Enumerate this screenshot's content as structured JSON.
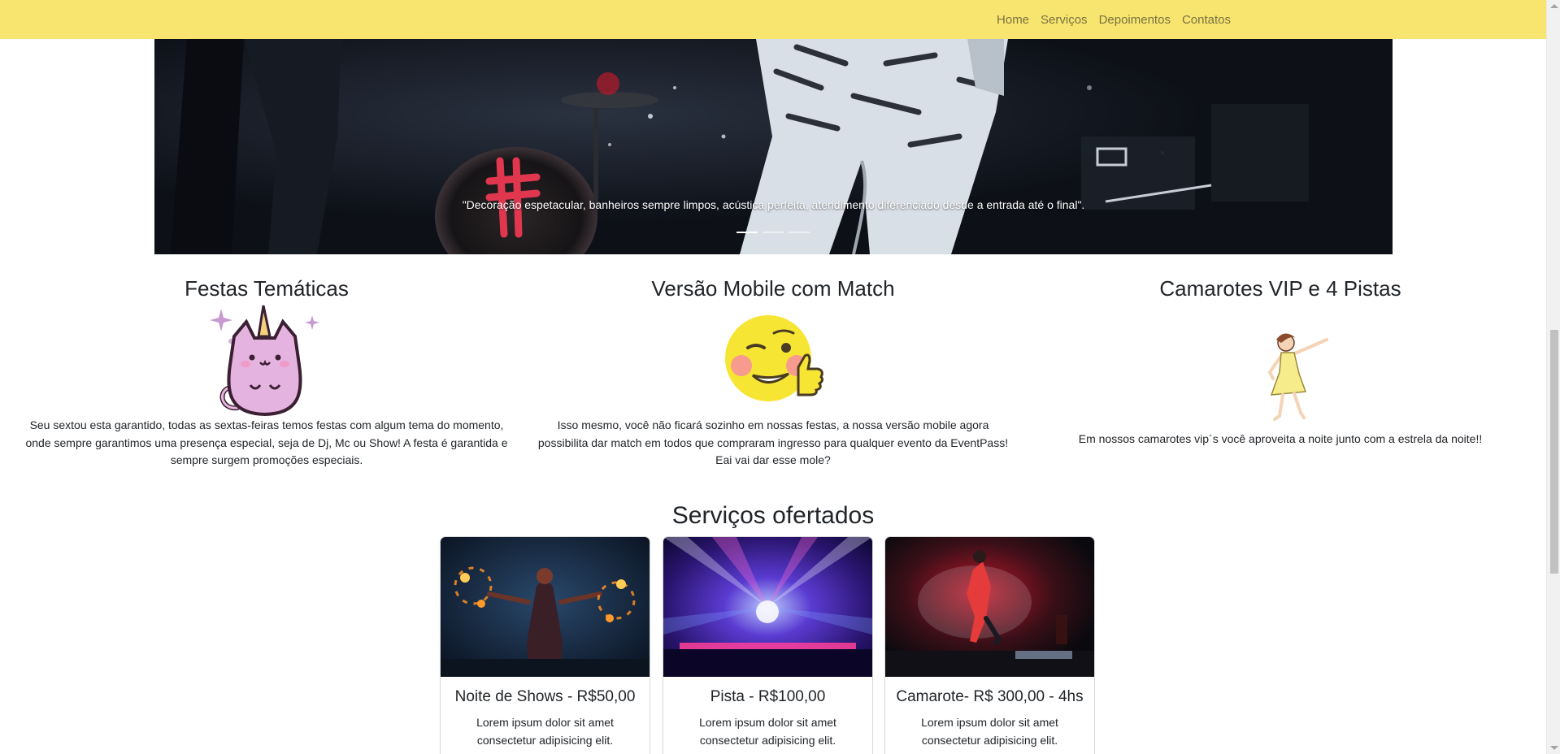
{
  "nav": {
    "links": [
      "Home",
      "Serviços",
      "Depoimentos",
      "Contatos"
    ]
  },
  "carousel": {
    "caption": "\"Decoração espetacular, banheiros sempre limpos, acústica perfeita, atendimento diferenciado desde a entrada até o final\".",
    "slide_count": 3,
    "active_slide": 1
  },
  "features": [
    {
      "title": "Festas Temáticas",
      "icon": "unicorn-cat-icon",
      "text": "Seu sextou esta garantido, todas as sextas-feiras temos festas com algum tema do momento, onde sempre garantimos uma presença especial, seja de Dj, Mc ou Show! A festa é garantida e sempre surgem promoções especiais."
    },
    {
      "title": "Versão Mobile com Match",
      "icon": "winking-thumbs-up-emoji-icon",
      "text": "Isso mesmo, você não ficará sozinho em nossas festas, a nossa versão mobile agora possibilita dar match em todos que compraram ingresso para qualquer evento da EventPass! Eai vai dar esse mole?"
    },
    {
      "title": "Camarotes VIP e 4 Pistas",
      "icon": "dancing-girl-icon",
      "text": "Em nossos camarotes vip´s você aproveita a noite junto com a estrela da noite!!"
    }
  ],
  "services": {
    "title": "Serviços ofertados",
    "cards": [
      {
        "title": "Noite de Shows - R$50,00",
        "text": "Lorem ipsum dolor sit amet consectetur adipisicing elit.",
        "image": "fire-dancer-photo"
      },
      {
        "title": "Pista - R$100,00",
        "text": "Lorem ipsum dolor sit amet consectetur adipisicing elit.",
        "image": "concert-stage-lights-photo"
      },
      {
        "title": "Camarote- R$ 300,00 - 4hs",
        "text": "Lorem ipsum dolor sit amet consectetur adipisicing elit.",
        "image": "breakdancer-photo"
      }
    ]
  },
  "colors": {
    "navbar_bg": "#f7e570",
    "nav_link": "#7a7240"
  }
}
